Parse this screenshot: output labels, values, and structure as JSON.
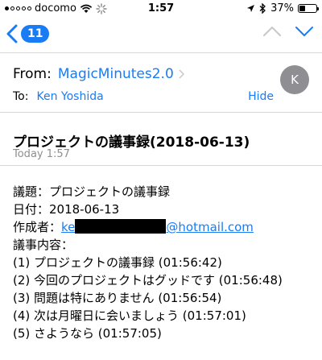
{
  "status_bar": {
    "carrier": "docomo",
    "time": "1:57",
    "battery": "37%",
    "battery_level": 0.37
  },
  "nav": {
    "unread_count": "11"
  },
  "header": {
    "from_label": "From:",
    "from_name": "MagicMinutes2.0",
    "to_label": "To:",
    "to_name": "Ken Yoshida",
    "hide_label": "Hide",
    "avatar_initial": "K"
  },
  "message": {
    "subject": "プロジェクトの議事録(2018-06-13)",
    "date": "Today 1:57"
  },
  "body": {
    "line1": "議題：プロジェクトの議事録",
    "line2": "日付：2018-06-13",
    "author_label": "作成者：",
    "author_prefix": "ke",
    "author_suffix": "@hotmail.com",
    "line4": "議事内容：",
    "items": [
      "(1) プロジェクトの議事録 (01:56:42)",
      "(2) 今回のプロジェクトはグッドです (01:56:48)",
      "(3) 問題は特にありません (01:56:54)",
      "(4) 次は月曜日に会いましょう (01:57:01)",
      "(5) さようなら (01:57:05)"
    ]
  },
  "colors": {
    "accent": "#1a7cf5",
    "gray": "#8e8e93"
  }
}
